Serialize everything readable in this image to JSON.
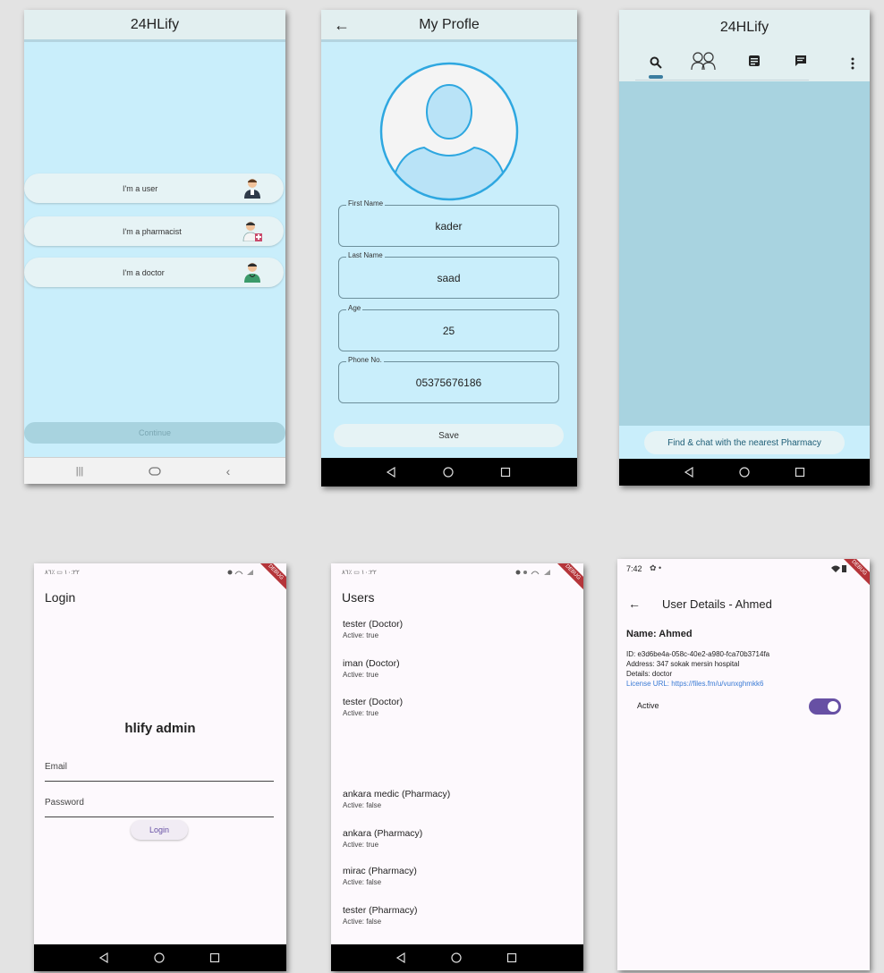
{
  "screen1": {
    "app_title": "24HLify",
    "roles": [
      {
        "label": "I'm a user",
        "icon": "user-avatar-icon"
      },
      {
        "label": "I'm a pharmacist",
        "icon": "pharmacist-avatar-icon"
      },
      {
        "label": "I'm a doctor",
        "icon": "doctor-avatar-icon"
      }
    ],
    "continue_label": "Continue"
  },
  "screen2": {
    "title": "My Profle",
    "fields": [
      {
        "label": "First Name",
        "value": "kader"
      },
      {
        "label": "Last Name",
        "value": "saad"
      },
      {
        "label": "Age",
        "value": "25"
      },
      {
        "label": "Phone No.",
        "value": "05375676186"
      }
    ],
    "save_label": "Save"
  },
  "screen3": {
    "app_title": "24HLify",
    "tabs": [
      "search-icon",
      "doctors-icon",
      "notes-icon",
      "chat-icon",
      "more-vert-icon"
    ],
    "find_label": "Find & chat with the nearest Pharmacy"
  },
  "screen4": {
    "status_left": "١٠:٢٢ ▭ ٪٨٦",
    "debug": "DEBUG",
    "title": "Login",
    "brand": "hlify admin",
    "email_placeholder": "Email",
    "password_placeholder": "Password",
    "login_label": "Login"
  },
  "screen5": {
    "status_left": "١٠:٢٢ ▭ ٪٨٦",
    "debug": "DEBUG",
    "title": "Users",
    "users": [
      {
        "name": "tester (Doctor)",
        "status": "Active: true"
      },
      {
        "name": "iman (Doctor)",
        "status": "Active: true"
      },
      {
        "name": "tester (Doctor)",
        "status": "Active: true"
      },
      {
        "name": "ankara medic (Pharmacy)",
        "status": "Active: false"
      },
      {
        "name": "ankara (Pharmacy)",
        "status": "Active: true"
      },
      {
        "name": "mirac (Pharmacy)",
        "status": "Active: false"
      },
      {
        "name": "tester (Pharmacy)",
        "status": "Active: false"
      }
    ]
  },
  "screen6": {
    "status_time": "7:42",
    "debug": "DEBUG",
    "title": "User Details - Ahmed",
    "name_line": "Name: Ahmed",
    "id_line": "ID: e3d6be4a-058c-40e2-a980-fca70b3714fa",
    "address_line": "Address: 347 sokak mersin hospital",
    "details_line": "Details: doctor",
    "license_line": "License URL: https://files.fm/u/vunxghmkk6",
    "active_label": "Active",
    "active_value": true,
    "colors": {
      "accent": "#6750a4",
      "link": "#3a7bd5"
    }
  }
}
